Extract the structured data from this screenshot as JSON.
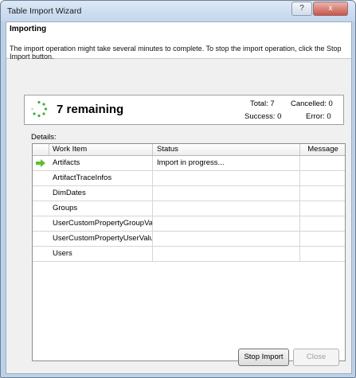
{
  "window": {
    "title": "Table Import Wizard",
    "help_glyph": "?",
    "close_glyph": "x"
  },
  "header": {
    "heading": "Importing",
    "description": "The import operation might take several minutes to complete. To stop the import operation, click the Stop Import button."
  },
  "status": {
    "remaining": "7 remaining",
    "total": "Total: 7",
    "cancelled": "Cancelled: 0",
    "success": "Success: 0",
    "error": "Error: 0"
  },
  "details": {
    "label": "Details:",
    "columns": [
      "Work Item",
      "Status",
      "Message"
    ],
    "rows": [
      {
        "work_item": "Artifacts",
        "status": "Import in progress...",
        "message": ""
      },
      {
        "work_item": "ArtifactTraceInfos",
        "status": "",
        "message": ""
      },
      {
        "work_item": "DimDates",
        "status": "",
        "message": ""
      },
      {
        "work_item": "Groups",
        "status": "",
        "message": ""
      },
      {
        "work_item": "UserCustomPropertyGroupVal...",
        "status": "",
        "message": ""
      },
      {
        "work_item": "UserCustomPropertyUserValues",
        "status": "",
        "message": ""
      },
      {
        "work_item": "Users",
        "status": "",
        "message": ""
      }
    ]
  },
  "buttons": {
    "stop_import": "Stop Import",
    "close": "Close"
  },
  "icons": {
    "current_row": "green-right-arrow-icon",
    "spinner": "loading-spinner-icon"
  },
  "colors": {
    "spinner": "#3fae3f",
    "arrow": "#5fbf2f",
    "title_bar": "#c3d6ec"
  }
}
